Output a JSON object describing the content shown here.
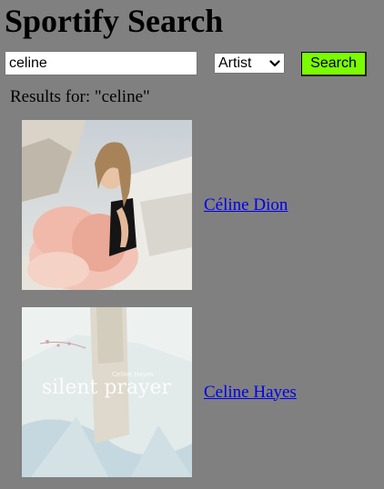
{
  "header": {
    "title": "Sportify Search"
  },
  "search": {
    "query": "celine",
    "type_selected": "Artist",
    "button_label": "Search"
  },
  "results": {
    "heading": "Results for: \"celine\"",
    "items": [
      {
        "name": "Céline Dion"
      },
      {
        "name": "Celine Hayes",
        "cover_text": "silent prayer",
        "cover_subtext": "Celine Hayes"
      }
    ]
  }
}
